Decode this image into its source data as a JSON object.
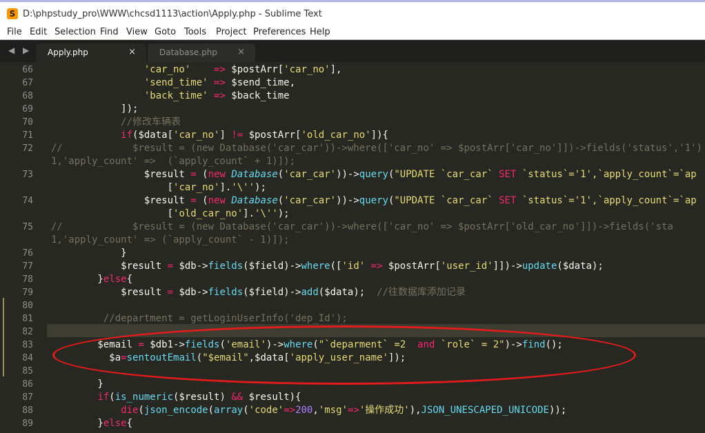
{
  "window": {
    "title": "D:\\phpstudy_pro\\WWW\\chcsd1113\\action\\Apply.php - Sublime Text",
    "icon_glyph": "S"
  },
  "menu": [
    "File",
    "Edit",
    "Selection",
    "Find",
    "View",
    "Goto",
    "Tools",
    "Project",
    "Preferences",
    "Help"
  ],
  "tabs": [
    {
      "label": "Apply.php",
      "close": "×"
    },
    {
      "label": "Database.php",
      "close": "×"
    }
  ],
  "nav": "◀ ▶",
  "line_numbers": [
    "66",
    "67",
    "68",
    "69",
    "70",
    "71",
    "72",
    "",
    "73",
    "",
    "74",
    "",
    "75",
    "",
    "76",
    "77",
    "78",
    "79",
    "80",
    "81",
    "82",
    "83",
    "84",
    "85",
    "86",
    "87",
    "88",
    "89"
  ],
  "code": [
    [
      {
        "t": "                ",
        "c": "v"
      },
      {
        "t": "'car_no'",
        "c": "s"
      },
      {
        "t": "    ",
        "c": "v"
      },
      {
        "t": "=>",
        "c": "k"
      },
      {
        "t": " $postArr[",
        "c": "v"
      },
      {
        "t": "'car_no'",
        "c": "s"
      },
      {
        "t": "],",
        "c": "v"
      }
    ],
    [
      {
        "t": "                ",
        "c": "v"
      },
      {
        "t": "'send_time'",
        "c": "s"
      },
      {
        "t": " ",
        "c": "v"
      },
      {
        "t": "=>",
        "c": "k"
      },
      {
        "t": " $send_time,",
        "c": "v"
      }
    ],
    [
      {
        "t": "                ",
        "c": "v"
      },
      {
        "t": "'back_time'",
        "c": "s"
      },
      {
        "t": " ",
        "c": "v"
      },
      {
        "t": "=>",
        "c": "k"
      },
      {
        "t": " $back_time",
        "c": "v"
      }
    ],
    [
      {
        "t": "            ]);",
        "c": "v"
      }
    ],
    [
      {
        "t": "            ",
        "c": "v"
      },
      {
        "t": "//修改车辆表",
        "c": "c"
      }
    ],
    [
      {
        "t": "            ",
        "c": "v"
      },
      {
        "t": "if",
        "c": "k"
      },
      {
        "t": "($data[",
        "c": "v"
      },
      {
        "t": "'car_no'",
        "c": "s"
      },
      {
        "t": "] ",
        "c": "v"
      },
      {
        "t": "!=",
        "c": "k"
      },
      {
        "t": " $postArr[",
        "c": "v"
      },
      {
        "t": "'old_car_no'",
        "c": "s"
      },
      {
        "t": "]){",
        "c": "v"
      }
    ],
    [
      {
        "t": "//            $result = (new Database('car_car'))->where(['car_no' => $postArr['car_no']])->fields('status','1')",
        "c": "c"
      }
    ],
    [
      {
        "t": "1,'apply_count' =>  (`apply_count` + 1)]);",
        "c": "c"
      }
    ],
    [
      {
        "t": "                $result ",
        "c": "v"
      },
      {
        "t": "=",
        "c": "k"
      },
      {
        "t": " (",
        "c": "v"
      },
      {
        "t": "new",
        "c": "k"
      },
      {
        "t": " ",
        "c": "v"
      },
      {
        "t": "Database",
        "c": "t"
      },
      {
        "t": "(",
        "c": "v"
      },
      {
        "t": "'car_car'",
        "c": "s"
      },
      {
        "t": "))->",
        "c": "v"
      },
      {
        "t": "query",
        "c": "f"
      },
      {
        "t": "(",
        "c": "v"
      },
      {
        "t": "\"UPDATE `car_car` ",
        "c": "s"
      },
      {
        "t": "SET",
        "c": "k"
      },
      {
        "t": " `status`='1',`apply_count`=`ap",
        "c": "s"
      }
    ],
    [
      {
        "t": "                    [",
        "c": "v"
      },
      {
        "t": "'car_no'",
        "c": "s"
      },
      {
        "t": "].",
        "c": "v"
      },
      {
        "t": "'\\''",
        "c": "s"
      },
      {
        "t": ");",
        "c": "v"
      }
    ],
    [
      {
        "t": "                $result ",
        "c": "v"
      },
      {
        "t": "=",
        "c": "k"
      },
      {
        "t": " (",
        "c": "v"
      },
      {
        "t": "new",
        "c": "k"
      },
      {
        "t": " ",
        "c": "v"
      },
      {
        "t": "Database",
        "c": "t"
      },
      {
        "t": "(",
        "c": "v"
      },
      {
        "t": "'car_car'",
        "c": "s"
      },
      {
        "t": "))->",
        "c": "v"
      },
      {
        "t": "query",
        "c": "f"
      },
      {
        "t": "(",
        "c": "v"
      },
      {
        "t": "\"UPDATE `car_car` ",
        "c": "s"
      },
      {
        "t": "SET",
        "c": "k"
      },
      {
        "t": " `status`='1',`apply_count`=`ap",
        "c": "s"
      }
    ],
    [
      {
        "t": "                    [",
        "c": "v"
      },
      {
        "t": "'old_car_no'",
        "c": "s"
      },
      {
        "t": "].",
        "c": "v"
      },
      {
        "t": "'\\''",
        "c": "s"
      },
      {
        "t": ");",
        "c": "v"
      }
    ],
    [
      {
        "t": "//            $result = (new Database('car_car'))->where(['car_no' => $postArr['old_car_no']])->fields('sta",
        "c": "c"
      }
    ],
    [
      {
        "t": "1,'apply_count' => (`apply_count` - 1)]);",
        "c": "c"
      }
    ],
    [
      {
        "t": "            }",
        "c": "v"
      }
    ],
    [
      {
        "t": "            $result ",
        "c": "v"
      },
      {
        "t": "=",
        "c": "k"
      },
      {
        "t": " $db->",
        "c": "v"
      },
      {
        "t": "fields",
        "c": "f"
      },
      {
        "t": "($field)->",
        "c": "v"
      },
      {
        "t": "where",
        "c": "f"
      },
      {
        "t": "([",
        "c": "v"
      },
      {
        "t": "'id'",
        "c": "s"
      },
      {
        "t": " ",
        "c": "v"
      },
      {
        "t": "=>",
        "c": "k"
      },
      {
        "t": " $postArr[",
        "c": "v"
      },
      {
        "t": "'user_id'",
        "c": "s"
      },
      {
        "t": "]])->",
        "c": "v"
      },
      {
        "t": "update",
        "c": "f"
      },
      {
        "t": "($data);",
        "c": "v"
      }
    ],
    [
      {
        "t": "        }",
        "c": "v"
      },
      {
        "t": "else",
        "c": "k"
      },
      {
        "t": "{",
        "c": "v"
      }
    ],
    [
      {
        "t": "            $result ",
        "c": "v"
      },
      {
        "t": "=",
        "c": "k"
      },
      {
        "t": " $db->",
        "c": "v"
      },
      {
        "t": "fields",
        "c": "f"
      },
      {
        "t": "($field)->",
        "c": "v"
      },
      {
        "t": "add",
        "c": "f"
      },
      {
        "t": "($data);  ",
        "c": "v"
      },
      {
        "t": "//往数据库添加记录",
        "c": "c"
      }
    ],
    [
      {
        "t": "",
        "c": "v"
      }
    ],
    [
      {
        "t": "         ",
        "c": "v"
      },
      {
        "t": "//department = getLoginUserInfo('dep_Id');",
        "c": "c"
      }
    ],
    [
      {
        "t": "",
        "c": "v"
      }
    ],
    [
      {
        "t": "        $email ",
        "c": "v"
      },
      {
        "t": "=",
        "c": "k"
      },
      {
        "t": " $db1->",
        "c": "v"
      },
      {
        "t": "fields",
        "c": "f"
      },
      {
        "t": "(",
        "c": "v"
      },
      {
        "t": "'email'",
        "c": "s"
      },
      {
        "t": ")->",
        "c": "v"
      },
      {
        "t": "where",
        "c": "f"
      },
      {
        "t": "(",
        "c": "v"
      },
      {
        "t": "\"`deparment` =2  ",
        "c": "s"
      },
      {
        "t": "and",
        "c": "k"
      },
      {
        "t": " `role` = 2\"",
        "c": "s"
      },
      {
        "t": ")->",
        "c": "v"
      },
      {
        "t": "find",
        "c": "f"
      },
      {
        "t": "();",
        "c": "v"
      }
    ],
    [
      {
        "t": "          $a",
        "c": "v"
      },
      {
        "t": "=",
        "c": "k"
      },
      {
        "t": "sentoutEmail",
        "c": "f"
      },
      {
        "t": "(",
        "c": "v"
      },
      {
        "t": "\"$email\"",
        "c": "s"
      },
      {
        "t": ",$data[",
        "c": "v"
      },
      {
        "t": "'apply_user_name'",
        "c": "s"
      },
      {
        "t": "]);",
        "c": "v"
      }
    ],
    [
      {
        "t": "",
        "c": "v"
      }
    ],
    [
      {
        "t": "        }",
        "c": "v"
      }
    ],
    [
      {
        "t": "        ",
        "c": "v"
      },
      {
        "t": "if",
        "c": "k"
      },
      {
        "t": "(",
        "c": "v"
      },
      {
        "t": "is_numeric",
        "c": "f"
      },
      {
        "t": "($result) ",
        "c": "v"
      },
      {
        "t": "&&",
        "c": "k"
      },
      {
        "t": " $result){",
        "c": "v"
      }
    ],
    [
      {
        "t": "            ",
        "c": "v"
      },
      {
        "t": "die",
        "c": "k"
      },
      {
        "t": "(",
        "c": "v"
      },
      {
        "t": "json_encode",
        "c": "f"
      },
      {
        "t": "(",
        "c": "v"
      },
      {
        "t": "array",
        "c": "f"
      },
      {
        "t": "(",
        "c": "v"
      },
      {
        "t": "'code'",
        "c": "s"
      },
      {
        "t": "=>",
        "c": "k"
      },
      {
        "t": "200",
        "c": "n"
      },
      {
        "t": ",",
        "c": "v"
      },
      {
        "t": "'msg'",
        "c": "s"
      },
      {
        "t": "=>",
        "c": "k"
      },
      {
        "t": "'操作成功'",
        "c": "s"
      },
      {
        "t": "),",
        "c": "v"
      },
      {
        "t": "JSON_UNESCAPED_UNICODE",
        "c": "f"
      },
      {
        "t": "));",
        "c": "v"
      }
    ],
    [
      {
        "t": "        }",
        "c": "v"
      },
      {
        "t": "else",
        "c": "k"
      },
      {
        "t": "{",
        "c": "v"
      }
    ]
  ]
}
